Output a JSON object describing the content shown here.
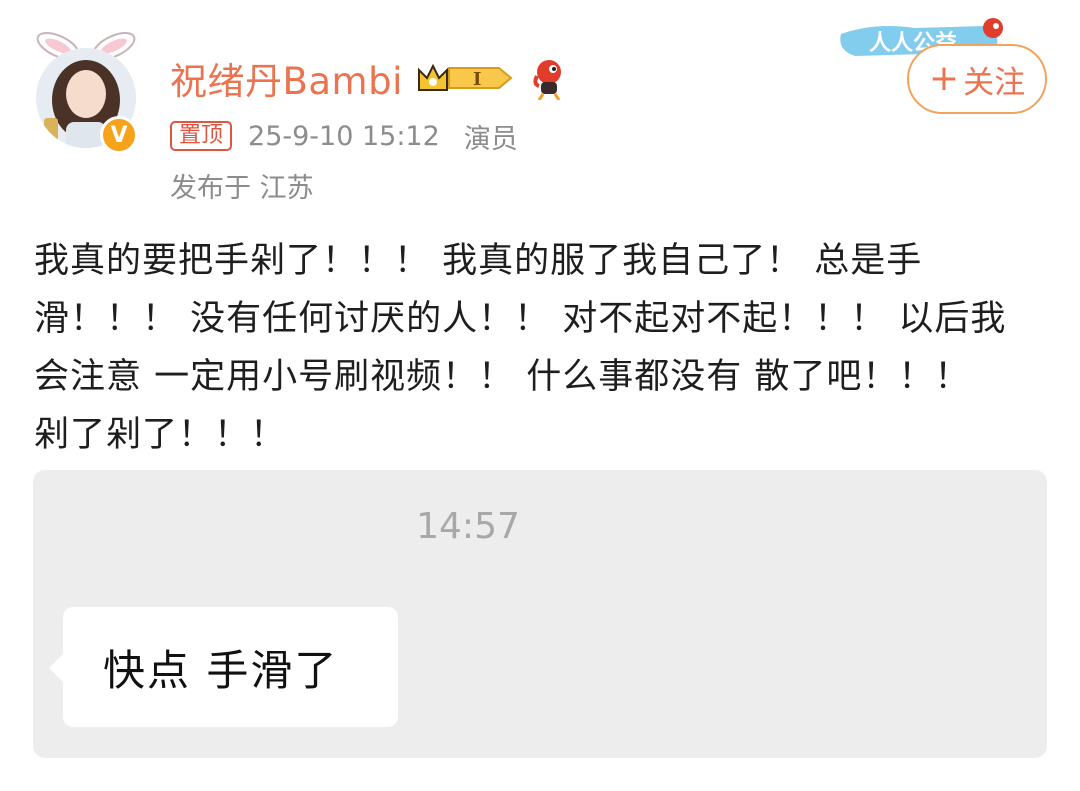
{
  "post": {
    "author": {
      "name": "祝绪丹Bambi",
      "verified_mark": "V",
      "level_badge": "I",
      "icons": [
        "bunny-ears-icon",
        "crown-badge-icon",
        "mascot-icon"
      ]
    },
    "pin_label": "置顶",
    "timestamp": "25-9-10 15:12",
    "profession": "演员",
    "location": "发布于 江苏",
    "follow_button": {
      "plus": "+",
      "label": "关注"
    },
    "banner_text": "人人公益",
    "content_lines": [
      "我真的要把手剁了！！！ 我真的服了我自己了！ 总是手",
      "滑！！！ 没有任何讨厌的人！！ 对不起对不起！！！ 以后我",
      "会注意 一定用小号刷视频！！ 什么事都没有 散了吧！！！",
      "剁了剁了！！！"
    ]
  },
  "screenshot": {
    "time": "14:57",
    "message": "快点 手滑了"
  },
  "colors": {
    "username": "#eb7350",
    "accent_orange": "#f0a35c",
    "pin_red": "#e0553f",
    "meta_gray": "#8c8c8c",
    "chat_bg": "#ededed"
  }
}
